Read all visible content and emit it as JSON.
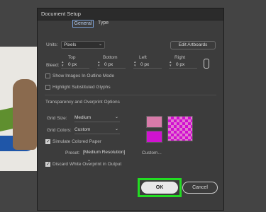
{
  "dialog": {
    "title": "Document Setup"
  },
  "tabs": [
    {
      "label": "General",
      "selected": true
    },
    {
      "label": "Type",
      "selected": false
    }
  ],
  "units": {
    "label": "Units:",
    "value": "Pixels"
  },
  "edit_artboards": "Edit Artboards",
  "bleed": {
    "label": "Bleed:",
    "headers": [
      "Top",
      "Bottom",
      "Left",
      "Right"
    ],
    "values": [
      "0 px",
      "0 px",
      "0 px",
      "0 px"
    ]
  },
  "options": {
    "show_images_outline": {
      "label": "Show Images In Outline Mode",
      "checked": false
    },
    "highlight_glyphs": {
      "label": "Highlight Substituted Glyphs",
      "checked": false
    }
  },
  "transparency": {
    "heading": "Transparency and Overprint Options",
    "grid_size": {
      "label": "Grid Size:",
      "value": "Medium"
    },
    "grid_colors": {
      "label": "Grid Colors:",
      "value": "Custom"
    },
    "simulate_paper": {
      "label": "Simulate Colored Paper",
      "checked": true
    },
    "preset": {
      "label": "Preset:",
      "value": "[Medium Resolution]"
    },
    "custom_button": "Custom...",
    "discard_white": {
      "label": "Discard White Overprint in Output",
      "checked": true
    },
    "swatch_colors": {
      "grid_light": "#d87aa9",
      "grid_dark": "#d013d0"
    }
  },
  "buttons": {
    "ok": "OK",
    "cancel": "Cancel"
  },
  "colors": {
    "highlight": "#22dd22",
    "background": "#444444",
    "dialog": "#3c3c3c"
  }
}
